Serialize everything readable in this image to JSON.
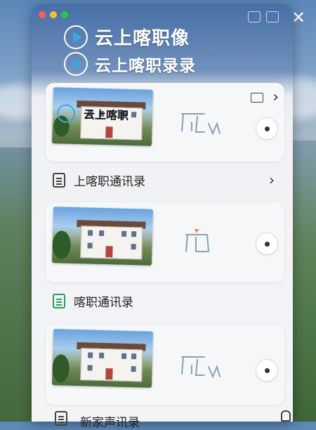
{
  "header": {
    "title": "云上喀职像",
    "subtitle": "云上喀职录录"
  },
  "top_card": {
    "overlay_text": "云上喀职",
    "folder_icon": "folder-icon",
    "chevron": "›"
  },
  "sections": [
    {
      "label": "上喀职通讯录",
      "icon": "document-icon",
      "chevron": "›"
    },
    {
      "label": "喀职通讯录",
      "icon": "document-icon-green"
    },
    {
      "label": "新家声讯录",
      "icon": "document-icon"
    }
  ],
  "colors": {
    "accent": "#39a9e0",
    "green_icon": "#2e9b58",
    "marker": "#e8823a"
  }
}
